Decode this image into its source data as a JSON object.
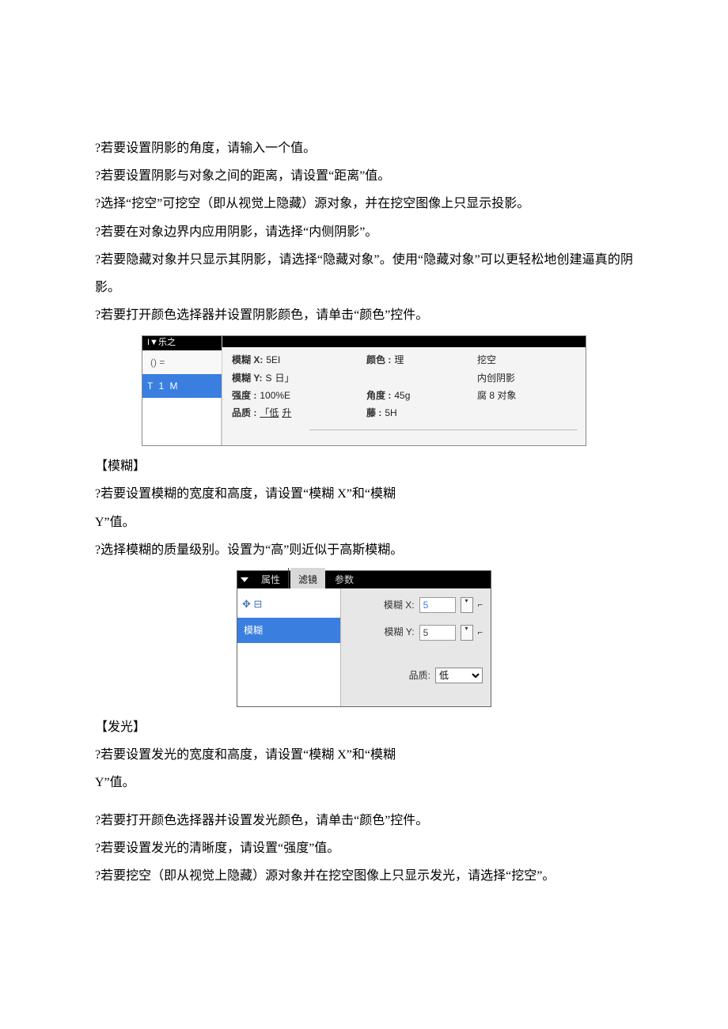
{
  "paragraphs": {
    "p1": "?若要设置阴影的角度，请输入一个值。",
    "p2": "?若要设置阴影与对象之间的距离，请设置“距离”值。",
    "p3": "?选择“挖空”可挖空（即从视觉上隐藏）源对象，并在挖空图像上只显示投影。",
    "p4": "?若要在对象边界内应用阴影，请选择“内侧阴影”。",
    "p5": "?若要隐藏对象并只显示其阴影，请选择“隐藏对象”。使用“隐藏对象”可以更轻松地创建逼真的阴影。",
    "p6": "?若要打开颜色选择器并设置阴影颜色，请单击“颜色”控件。",
    "h_blur": "【模糊】",
    "p7": "?若要设置模糊的宽度和高度，请设置“模糊 X”和“模糊",
    "p7b": "Y”值。",
    "p8": "?选择模糊的质量级别。设置为“高”则近似于高斯模糊。",
    "h_glow": "【发光】",
    "p9": "?若要设置发光的宽度和高度，请设置“模糊 X”和“模糊",
    "p9b": "Y”值。",
    "p10": "?若要打开颜色选择器并设置发光颜色，请单击“颜色”控件。",
    "p11": "?若要设置发光的清晰度，请设置“强度”值。",
    "p12": "?若要挖空（即从视觉上隐藏）源对象并在挖空图像上只显示发光，请选择“挖空”。"
  },
  "panel1": {
    "side_hdr": "I▼乐之",
    "side_sub": "() =",
    "side_sel": "T 1 M",
    "c1": {
      "blurx_label": "模糊 X:",
      "blurx_val": "5EI",
      "blury_label": "模糊 Y:",
      "blury_val": "S",
      "blury_unit": "日」",
      "str_label": "强度 :",
      "str_val": "100%E",
      "qual_label": "品质 :",
      "qual_val": "「低",
      "qual_sfx": "升"
    },
    "c2": {
      "color_label": "颜色 :",
      "color_val": "理",
      "angle_label": "角度 :",
      "angle_val": "45g",
      "dist_label": "藤 :",
      "dist_val": "5H"
    },
    "c3": {
      "knock": "挖空",
      "inner": "内创阴影",
      "hide": "腐 8 对象"
    }
  },
  "panel2": {
    "tabs": {
      "l": "属性",
      "a": "滤镜",
      "r": "参数"
    },
    "tool_glyph": "✥ ⊟",
    "sel_item": "模糊",
    "form": {
      "bx_label": "模糊 X:",
      "bx_val": "5",
      "by_label": "模糊 Y:",
      "by_val": "5",
      "q_label": "品质:",
      "q_val": "低"
    }
  }
}
